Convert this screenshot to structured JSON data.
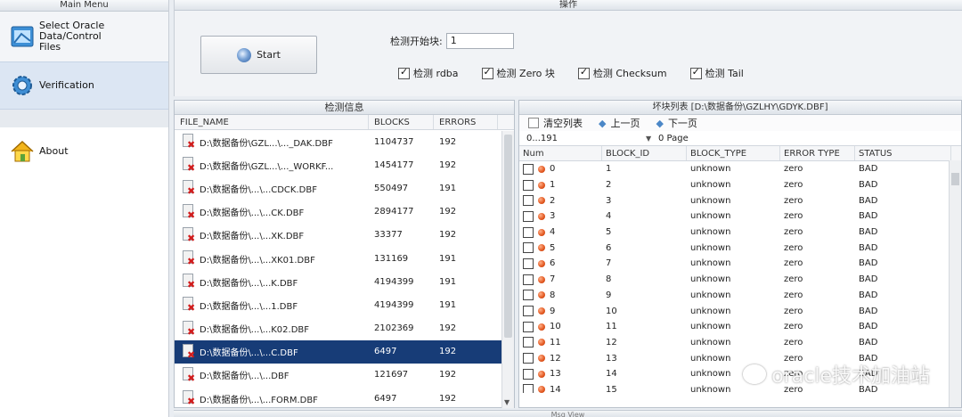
{
  "left_menu": {
    "title": "Main Menu",
    "items": [
      {
        "label_line1": "Select Oracle Data/Control",
        "label_line2": "Files",
        "icon": "datafile-icon"
      },
      {
        "label": "Verification",
        "icon": "gear-icon"
      },
      {
        "label": "About",
        "icon": "home-icon"
      }
    ]
  },
  "operations": {
    "title": "操作",
    "start_button": "Start",
    "start_block_label": "检测开始块:",
    "start_block_value": "1",
    "checks": [
      {
        "label": "检测 rdba",
        "checked": true
      },
      {
        "label": "检测 Zero 块",
        "checked": true
      },
      {
        "label": "检测 Checksum",
        "checked": true
      },
      {
        "label": "检测 Tail",
        "checked": true
      }
    ]
  },
  "check_info": {
    "title": "检测信息",
    "columns": [
      "FILE_NAME",
      "BLOCKS",
      "ERRORS"
    ],
    "rows": [
      {
        "file": "D:\\数据备份\\GZL...\\..._DAK.DBF",
        "blocks": "1104737",
        "errors": "192",
        "selected": false
      },
      {
        "file": "D:\\数据备份\\GZL...\\..._WORKF...",
        "blocks": "1454177",
        "errors": "192",
        "selected": false
      },
      {
        "file": "D:\\数据备份\\...\\...CDCK.DBF",
        "blocks": "550497",
        "errors": "191",
        "selected": false
      },
      {
        "file": "D:\\数据备份\\...\\...CK.DBF",
        "blocks": "2894177",
        "errors": "192",
        "selected": false
      },
      {
        "file": "D:\\数据备份\\...\\...XK.DBF",
        "blocks": "33377",
        "errors": "192",
        "selected": false
      },
      {
        "file": "D:\\数据备份\\...\\...XK01.DBF",
        "blocks": "131169",
        "errors": "191",
        "selected": false
      },
      {
        "file": "D:\\数据备份\\...\\...K.DBF",
        "blocks": "4194399",
        "errors": "191",
        "selected": false
      },
      {
        "file": "D:\\数据备份\\...\\...1.DBF",
        "blocks": "4194399",
        "errors": "191",
        "selected": false
      },
      {
        "file": "D:\\数据备份\\...\\...K02.DBF",
        "blocks": "2102369",
        "errors": "192",
        "selected": false
      },
      {
        "file": "D:\\数据备份\\...\\...C.DBF",
        "blocks": "6497",
        "errors": "192",
        "selected": true
      },
      {
        "file": "D:\\数据备份\\...\\...DBF",
        "blocks": "121697",
        "errors": "192",
        "selected": false
      },
      {
        "file": "D:\\数据备份\\...\\...FORM.DBF",
        "blocks": "6497",
        "errors": "192",
        "selected": false
      }
    ]
  },
  "bad_blocks": {
    "title": "坏块列表 [D:\\数据备份\\GZLHY\\GDYK.DBF]",
    "toolbar": {
      "clear": "清空列表",
      "prev": "上一页",
      "next": "下一页"
    },
    "range": "0...191",
    "page": "0 Page",
    "columns": [
      "Num",
      "BLOCK_ID",
      "BLOCK_TYPE",
      "ERROR TYPE",
      "STATUS"
    ],
    "rows": [
      {
        "num": "0",
        "id": "1",
        "type": "unknown",
        "err": "zero",
        "status": "BAD"
      },
      {
        "num": "1",
        "id": "2",
        "type": "unknown",
        "err": "zero",
        "status": "BAD"
      },
      {
        "num": "2",
        "id": "3",
        "type": "unknown",
        "err": "zero",
        "status": "BAD"
      },
      {
        "num": "3",
        "id": "4",
        "type": "unknown",
        "err": "zero",
        "status": "BAD"
      },
      {
        "num": "4",
        "id": "5",
        "type": "unknown",
        "err": "zero",
        "status": "BAD"
      },
      {
        "num": "5",
        "id": "6",
        "type": "unknown",
        "err": "zero",
        "status": "BAD"
      },
      {
        "num": "6",
        "id": "7",
        "type": "unknown",
        "err": "zero",
        "status": "BAD"
      },
      {
        "num": "7",
        "id": "8",
        "type": "unknown",
        "err": "zero",
        "status": "BAD"
      },
      {
        "num": "8",
        "id": "9",
        "type": "unknown",
        "err": "zero",
        "status": "BAD"
      },
      {
        "num": "9",
        "id": "10",
        "type": "unknown",
        "err": "zero",
        "status": "BAD"
      },
      {
        "num": "10",
        "id": "11",
        "type": "unknown",
        "err": "zero",
        "status": "BAD"
      },
      {
        "num": "11",
        "id": "12",
        "type": "unknown",
        "err": "zero",
        "status": "BAD"
      },
      {
        "num": "12",
        "id": "13",
        "type": "unknown",
        "err": "zero",
        "status": "BAD"
      },
      {
        "num": "13",
        "id": "14",
        "type": "unknown",
        "err": "zero",
        "status": "BAD"
      },
      {
        "num": "14",
        "id": "15",
        "type": "unknown",
        "err": "zero",
        "status": "BAD"
      }
    ]
  },
  "bottom_bar": {
    "label": "Msg View"
  },
  "watermark": {
    "text": "oracle技术加油站"
  }
}
